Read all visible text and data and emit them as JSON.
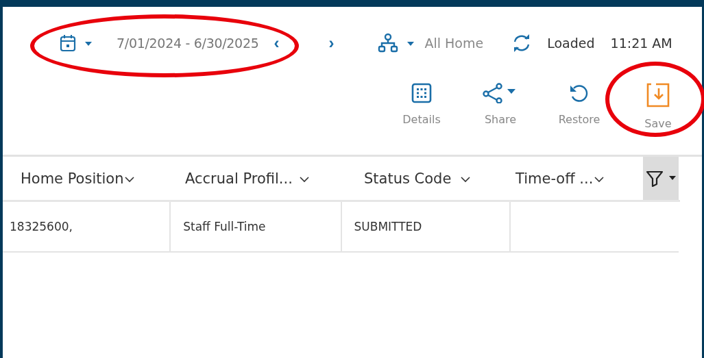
{
  "header": {
    "date_range": "7/01/2024 - 6/30/2025",
    "date_range_circled": true,
    "prev": "‹",
    "next": "›",
    "scope": "All Home",
    "status": "Loaded",
    "time": "11:21 AM"
  },
  "toolbar": [
    {
      "kind": "details",
      "label": "Details",
      "circled": false
    },
    {
      "kind": "share",
      "label": "Share",
      "circled": false
    },
    {
      "kind": "restore",
      "label": "Restore",
      "circled": false
    },
    {
      "kind": "save",
      "label": "Save",
      "circled": true
    }
  ],
  "table": {
    "columns": [
      "Home Position",
      "Accrual Profil...",
      "Status Code",
      "Time-off ..."
    ],
    "rows": [
      [
        "18325600,",
        "Staff Full-Time",
        "SUBMITTED"
      ]
    ]
  }
}
